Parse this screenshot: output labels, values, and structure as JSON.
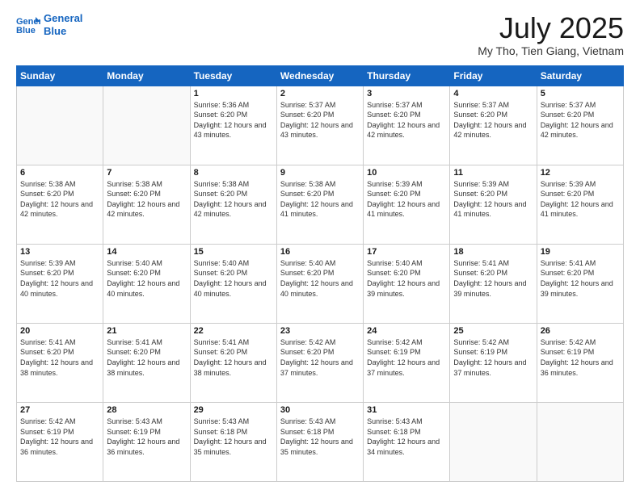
{
  "logo": {
    "line1": "General",
    "line2": "Blue"
  },
  "title": "July 2025",
  "subtitle": "My Tho, Tien Giang, Vietnam",
  "days_of_week": [
    "Sunday",
    "Monday",
    "Tuesday",
    "Wednesday",
    "Thursday",
    "Friday",
    "Saturday"
  ],
  "weeks": [
    [
      {
        "day": "",
        "info": ""
      },
      {
        "day": "",
        "info": ""
      },
      {
        "day": "1",
        "info": "Sunrise: 5:36 AM\nSunset: 6:20 PM\nDaylight: 12 hours and 43 minutes."
      },
      {
        "day": "2",
        "info": "Sunrise: 5:37 AM\nSunset: 6:20 PM\nDaylight: 12 hours and 43 minutes."
      },
      {
        "day": "3",
        "info": "Sunrise: 5:37 AM\nSunset: 6:20 PM\nDaylight: 12 hours and 42 minutes."
      },
      {
        "day": "4",
        "info": "Sunrise: 5:37 AM\nSunset: 6:20 PM\nDaylight: 12 hours and 42 minutes."
      },
      {
        "day": "5",
        "info": "Sunrise: 5:37 AM\nSunset: 6:20 PM\nDaylight: 12 hours and 42 minutes."
      }
    ],
    [
      {
        "day": "6",
        "info": "Sunrise: 5:38 AM\nSunset: 6:20 PM\nDaylight: 12 hours and 42 minutes."
      },
      {
        "day": "7",
        "info": "Sunrise: 5:38 AM\nSunset: 6:20 PM\nDaylight: 12 hours and 42 minutes."
      },
      {
        "day": "8",
        "info": "Sunrise: 5:38 AM\nSunset: 6:20 PM\nDaylight: 12 hours and 42 minutes."
      },
      {
        "day": "9",
        "info": "Sunrise: 5:38 AM\nSunset: 6:20 PM\nDaylight: 12 hours and 41 minutes."
      },
      {
        "day": "10",
        "info": "Sunrise: 5:39 AM\nSunset: 6:20 PM\nDaylight: 12 hours and 41 minutes."
      },
      {
        "day": "11",
        "info": "Sunrise: 5:39 AM\nSunset: 6:20 PM\nDaylight: 12 hours and 41 minutes."
      },
      {
        "day": "12",
        "info": "Sunrise: 5:39 AM\nSunset: 6:20 PM\nDaylight: 12 hours and 41 minutes."
      }
    ],
    [
      {
        "day": "13",
        "info": "Sunrise: 5:39 AM\nSunset: 6:20 PM\nDaylight: 12 hours and 40 minutes."
      },
      {
        "day": "14",
        "info": "Sunrise: 5:40 AM\nSunset: 6:20 PM\nDaylight: 12 hours and 40 minutes."
      },
      {
        "day": "15",
        "info": "Sunrise: 5:40 AM\nSunset: 6:20 PM\nDaylight: 12 hours and 40 minutes."
      },
      {
        "day": "16",
        "info": "Sunrise: 5:40 AM\nSunset: 6:20 PM\nDaylight: 12 hours and 40 minutes."
      },
      {
        "day": "17",
        "info": "Sunrise: 5:40 AM\nSunset: 6:20 PM\nDaylight: 12 hours and 39 minutes."
      },
      {
        "day": "18",
        "info": "Sunrise: 5:41 AM\nSunset: 6:20 PM\nDaylight: 12 hours and 39 minutes."
      },
      {
        "day": "19",
        "info": "Sunrise: 5:41 AM\nSunset: 6:20 PM\nDaylight: 12 hours and 39 minutes."
      }
    ],
    [
      {
        "day": "20",
        "info": "Sunrise: 5:41 AM\nSunset: 6:20 PM\nDaylight: 12 hours and 38 minutes."
      },
      {
        "day": "21",
        "info": "Sunrise: 5:41 AM\nSunset: 6:20 PM\nDaylight: 12 hours and 38 minutes."
      },
      {
        "day": "22",
        "info": "Sunrise: 5:41 AM\nSunset: 6:20 PM\nDaylight: 12 hours and 38 minutes."
      },
      {
        "day": "23",
        "info": "Sunrise: 5:42 AM\nSunset: 6:20 PM\nDaylight: 12 hours and 37 minutes."
      },
      {
        "day": "24",
        "info": "Sunrise: 5:42 AM\nSunset: 6:19 PM\nDaylight: 12 hours and 37 minutes."
      },
      {
        "day": "25",
        "info": "Sunrise: 5:42 AM\nSunset: 6:19 PM\nDaylight: 12 hours and 37 minutes."
      },
      {
        "day": "26",
        "info": "Sunrise: 5:42 AM\nSunset: 6:19 PM\nDaylight: 12 hours and 36 minutes."
      }
    ],
    [
      {
        "day": "27",
        "info": "Sunrise: 5:42 AM\nSunset: 6:19 PM\nDaylight: 12 hours and 36 minutes."
      },
      {
        "day": "28",
        "info": "Sunrise: 5:43 AM\nSunset: 6:19 PM\nDaylight: 12 hours and 36 minutes."
      },
      {
        "day": "29",
        "info": "Sunrise: 5:43 AM\nSunset: 6:18 PM\nDaylight: 12 hours and 35 minutes."
      },
      {
        "day": "30",
        "info": "Sunrise: 5:43 AM\nSunset: 6:18 PM\nDaylight: 12 hours and 35 minutes."
      },
      {
        "day": "31",
        "info": "Sunrise: 5:43 AM\nSunset: 6:18 PM\nDaylight: 12 hours and 34 minutes."
      },
      {
        "day": "",
        "info": ""
      },
      {
        "day": "",
        "info": ""
      }
    ]
  ]
}
